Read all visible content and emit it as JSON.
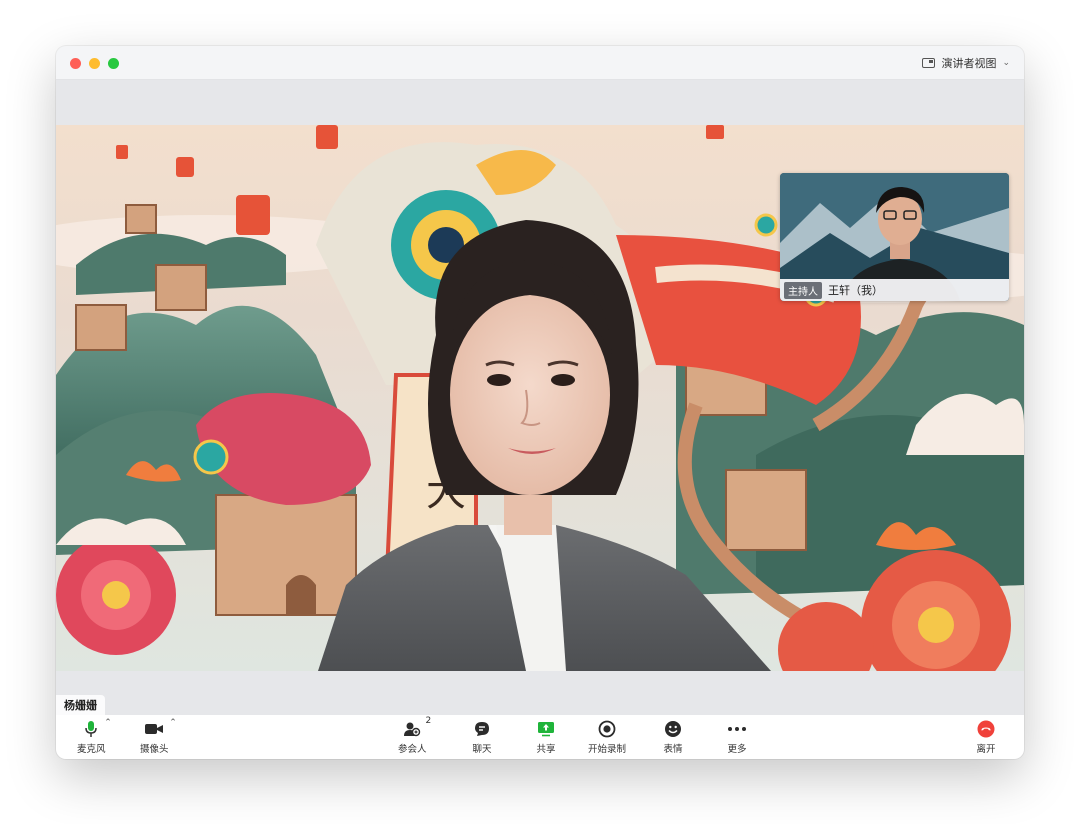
{
  "window": {
    "view_mode_label": "演讲者视图"
  },
  "pip": {
    "host_badge": "主持人",
    "participant_name": "王轩（我）"
  },
  "speaker": {
    "name": "杨姗姗"
  },
  "toolbar": {
    "mic_label": "麦克风",
    "camera_label": "摄像头",
    "participants_label": "参会人",
    "participants_count": "2",
    "chat_label": "聊天",
    "share_label": "共享",
    "record_label": "开始录制",
    "reaction_label": "表情",
    "more_label": "更多",
    "leave_label": "离开"
  },
  "colors": {
    "accent_green": "#1fb43a",
    "leave_red": "#f0413a"
  },
  "icons": [
    "microphone-icon",
    "camera-icon",
    "participants-icon",
    "chat-icon",
    "share-screen-icon",
    "record-icon",
    "emoji-icon",
    "more-icon",
    "hang-up-icon",
    "speaker-view-icon",
    "chevron-down-icon"
  ]
}
